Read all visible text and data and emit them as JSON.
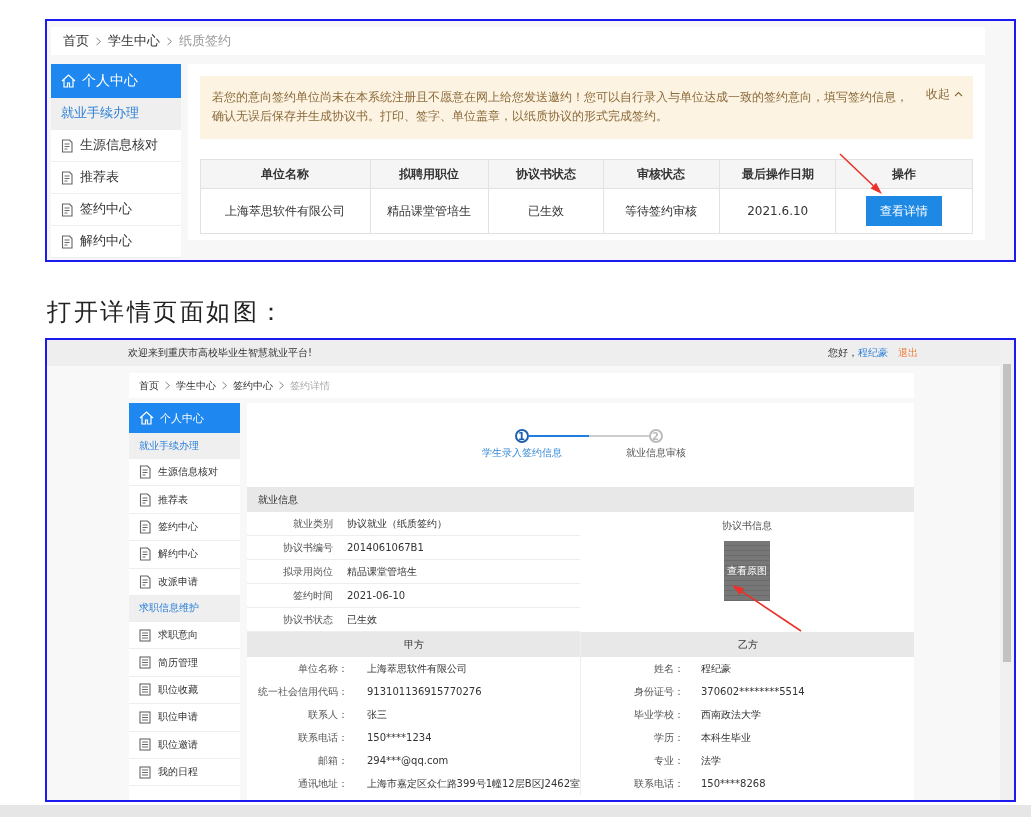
{
  "top_section": {
    "breadcrumb": [
      {
        "label": "首页",
        "current": false
      },
      {
        "label": "学生中心",
        "current": false
      },
      {
        "label": "纸质签约",
        "current": true
      }
    ],
    "sidebar": {
      "title": "个人中心",
      "items": [
        {
          "kind": "group",
          "label": "就业手续办理"
        },
        {
          "kind": "doc",
          "label": "生源信息核对"
        },
        {
          "kind": "doc",
          "label": "推荐表"
        },
        {
          "kind": "doc",
          "label": "签约中心"
        },
        {
          "kind": "doc",
          "label": "解约中心"
        }
      ]
    },
    "notice": {
      "text": "若您的意向签约单位尚未在本系统注册且不愿意在网上给您发送邀约！您可以自行录入与单位达成一致的签约意向，填写签约信息，确认无误后保存并生成协议书。打印、签字、单位盖章，以纸质协议的形式完成签约。",
      "toggle": "收起",
      "expanded": true
    },
    "table": {
      "columns": [
        "单位名称",
        "拟聘用职位",
        "协议书状态",
        "审核状态",
        "最后操作日期",
        "操作"
      ],
      "rows": [
        {
          "cells": [
            "上海萃思软件有限公司",
            "精品课堂管培生",
            "已生效",
            "等待签约审核",
            "2021.6.10"
          ],
          "action": "查看详情"
        }
      ]
    }
  },
  "caption": "打开详情页面如图：",
  "detail_section": {
    "top_bar": {
      "welcome": "欢迎来到重庆市高校毕业生智慧就业平台!",
      "greeting": "您好，",
      "user": "程纪豪",
      "logout": "退出"
    },
    "breadcrumb": [
      {
        "label": "首页",
        "current": false
      },
      {
        "label": "学生中心",
        "current": false
      },
      {
        "label": "签约中心",
        "current": false
      },
      {
        "label": "签约详情",
        "current": true
      }
    ],
    "sidebar": {
      "title": "个人中心",
      "items": [
        {
          "kind": "group",
          "label": "就业手续办理"
        },
        {
          "kind": "doc",
          "label": "生源信息核对"
        },
        {
          "kind": "doc",
          "label": "推荐表"
        },
        {
          "kind": "doc",
          "label": "签约中心"
        },
        {
          "kind": "doc",
          "label": "解约中心"
        },
        {
          "kind": "doc",
          "label": "改派申请"
        },
        {
          "kind": "group",
          "label": "求职信息维护"
        },
        {
          "kind": "list",
          "label": "求职意向"
        },
        {
          "kind": "list",
          "label": "简历管理"
        },
        {
          "kind": "list",
          "label": "职位收藏"
        },
        {
          "kind": "list",
          "label": "职位申请"
        },
        {
          "kind": "list",
          "label": "职位邀请"
        },
        {
          "kind": "list",
          "label": "我的日程"
        }
      ]
    },
    "steps": [
      {
        "number": "1",
        "label": "学生录入签约信息",
        "active": true
      },
      {
        "number": "2",
        "label": "就业信息审核",
        "active": false
      }
    ],
    "employment_info": {
      "title": "就业信息",
      "fields": [
        {
          "label": "就业类别",
          "value": "协议就业（纸质签约）"
        },
        {
          "label": "协议书编号",
          "value": "2014061067B1"
        },
        {
          "label": "拟录用岗位",
          "value": "精品课堂管培生"
        },
        {
          "label": "签约时间",
          "value": "2021-06-10"
        },
        {
          "label": "协议书状态",
          "value": "已生效"
        }
      ],
      "agreement": {
        "title": "协议书信息",
        "thumbnail_label": "查看原图"
      }
    },
    "parties": [
      {
        "title": "甲方",
        "fields": [
          {
            "label": "单位名称：",
            "value": "上海萃思软件有限公司"
          },
          {
            "label": "统一社会信用代码：",
            "value": "913101136915770276"
          },
          {
            "label": "联系人：",
            "value": "张三"
          },
          {
            "label": "联系电话：",
            "value": "150****1234"
          },
          {
            "label": "邮箱：",
            "value": "294***@qq.com"
          },
          {
            "label": "通讯地址：",
            "value": "上海市嘉定区众仁路399号1幢12层B区J2462室"
          }
        ]
      },
      {
        "title": "乙方",
        "fields": [
          {
            "label": "姓名：",
            "value": "程纪豪"
          },
          {
            "label": "身份证号：",
            "value": "370602********5514"
          },
          {
            "label": "毕业学校：",
            "value": "西南政法大学"
          },
          {
            "label": "学历：",
            "value": "本科生毕业"
          },
          {
            "label": "专业：",
            "value": "法学"
          },
          {
            "label": "联系电话：",
            "value": "150****8268"
          }
        ]
      }
    ]
  }
}
